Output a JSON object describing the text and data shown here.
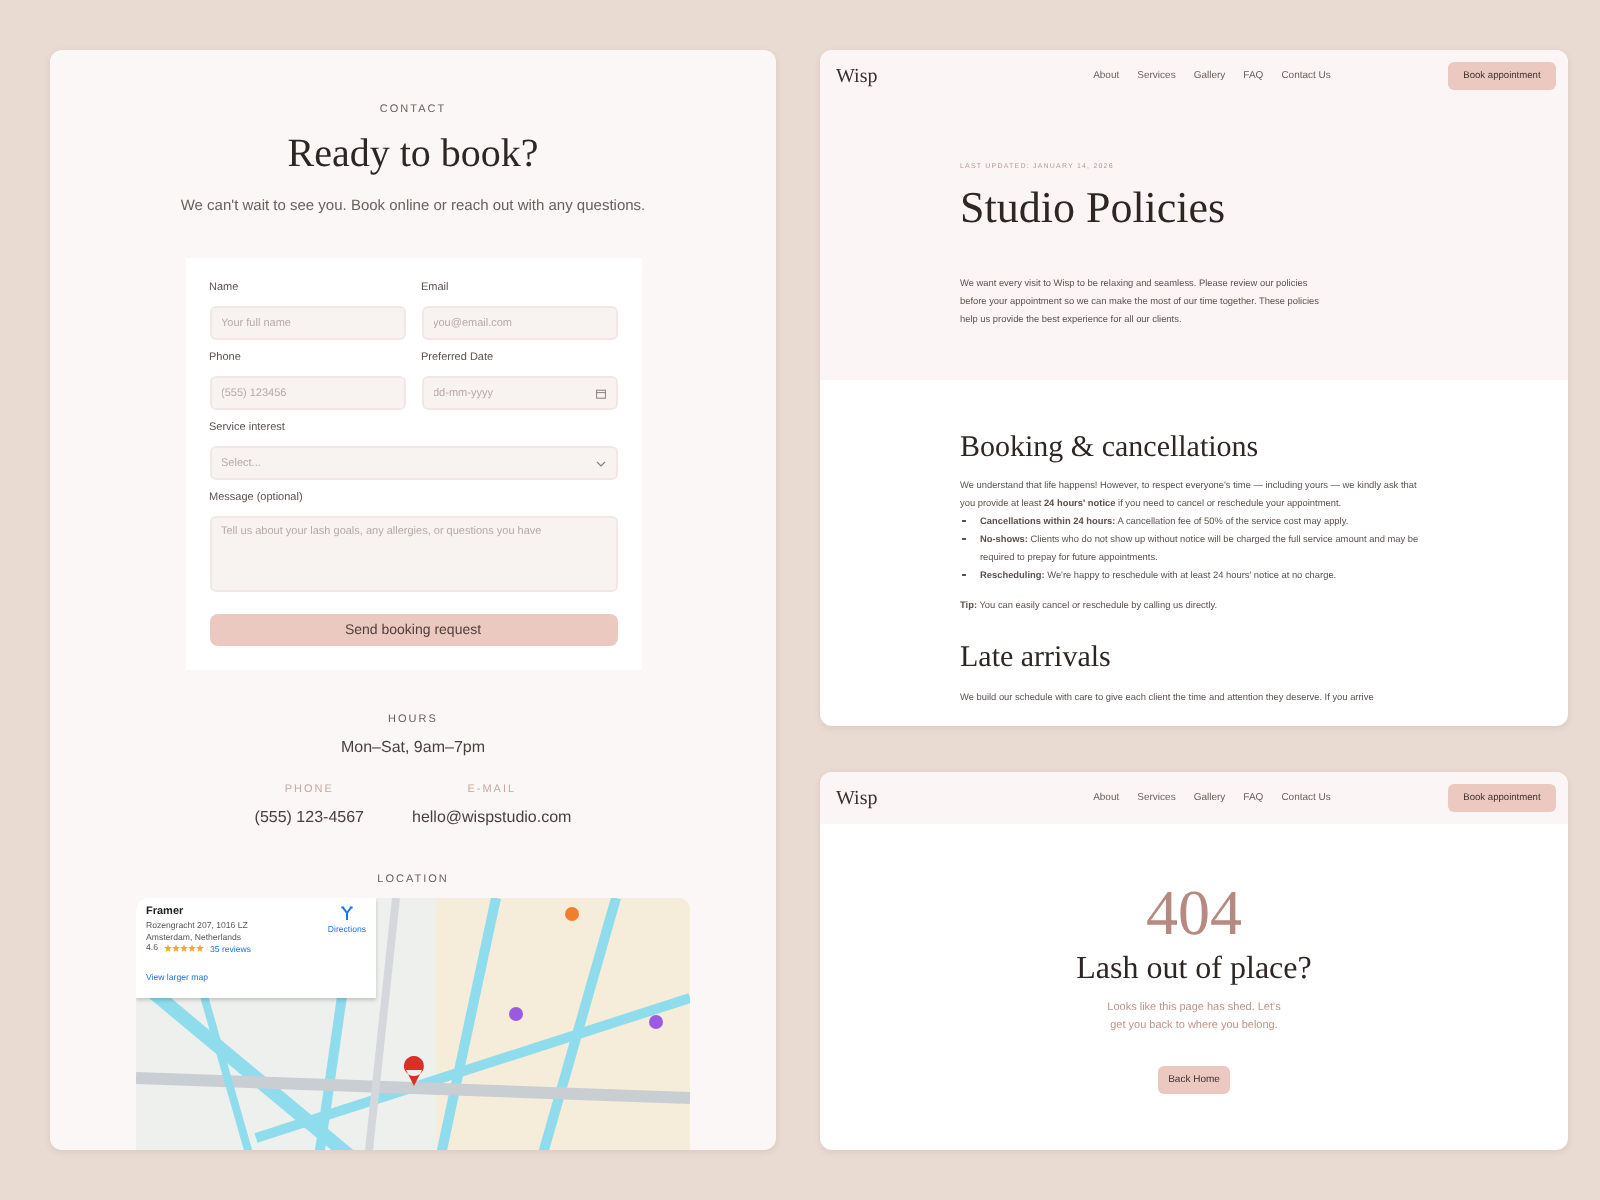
{
  "contact_page": {
    "eyebrow": "CONTACT",
    "title": "Ready to book?",
    "subtitle": "We can't wait to see you. Book online or reach out with any questions.",
    "form": {
      "fields": [
        {
          "label": "Name",
          "placeholder": "Your full name",
          "kind": "text"
        },
        {
          "label": "Email",
          "placeholder": "you@email.com",
          "kind": "text"
        },
        {
          "label": "Phone",
          "placeholder": "(555) 123456",
          "kind": "text"
        },
        {
          "label": "Preferred Date",
          "placeholder": "dd-mm-yyyy",
          "kind": "date"
        },
        {
          "label": "Service interest",
          "placeholder": "Select...",
          "kind": "select"
        },
        {
          "label": "Message (optional)",
          "placeholder": "Tell us about your lash goals, any allergies, or questions you have",
          "kind": "textarea"
        }
      ],
      "submit": "Send booking request"
    },
    "hours": {
      "label": "HOURS",
      "value": "Mon–Sat, 9am–7pm"
    },
    "contacts": [
      {
        "label": "PHONE",
        "value": "(555) 123-4567"
      },
      {
        "label": "E-MAIL",
        "value": "hello@wispstudio.com"
      }
    ],
    "location": {
      "label": "LOCATION",
      "map_card": {
        "name": "Framer",
        "address_lines": [
          "Rozengracht 207, 1016 LZ",
          "Amsterdam, Netherlands"
        ],
        "rating": "4.6",
        "stars": 5,
        "reviews": "35 reviews",
        "directions": "Directions",
        "link": "View larger map"
      }
    }
  },
  "policies_page": {
    "nav": {
      "logo": "Wisp",
      "links": [
        "About",
        "Services",
        "Gallery",
        "FAQ",
        "Contact Us"
      ],
      "cta": "Book appointment"
    },
    "updated": "LAST UPDATED: JANUARY 14, 2026",
    "title": "Studio Policies",
    "intro": "We want every visit to Wisp to be relaxing and seamless. Please review our policies before your appointment so we can make the most of our time together. These policies help us provide the best experience for all our clients.",
    "sections": [
      {
        "title": "Booking & cancellations",
        "body": "We understand that life happens! However, to respect everyone's time — including yours — we kindly ask that you provide at least **24 hours' notice** if you need to cancel or reschedule your appointment.",
        "bullets": [
          "**Cancellations within 24 hours:** A cancellation fee of 50% of the service cost may apply.",
          "**No-shows:** Clients who do not show up without notice will be charged the full service amount and may be required to prepay for future appointments.",
          "**Rescheduling:** We're happy to reschedule with at least 24 hours' notice at no charge."
        ],
        "tip": "**Tip:** You can easily cancel or reschedule by calling us directly."
      },
      {
        "title": "Late arrivals",
        "body": "We build our schedule with care to give each client the time and attention they deserve. If you arrive"
      }
    ]
  },
  "not_found_page": {
    "nav": {
      "logo": "Wisp",
      "links": [
        "About",
        "Services",
        "Gallery",
        "FAQ",
        "Contact Us"
      ],
      "cta": "Book appointment"
    },
    "code": "404",
    "title": "Lash out of place?",
    "message": "Looks like this page has shed. Let's get you back to where you belong.",
    "button": "Back Home"
  }
}
